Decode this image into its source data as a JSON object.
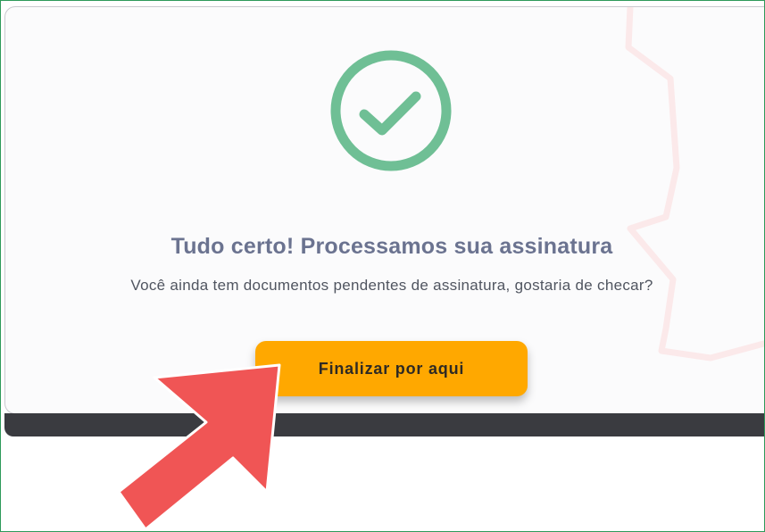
{
  "confirmation": {
    "title": "Tudo certo! Processamos sua assinatura",
    "message": "Você ainda tem documentos pendentes de assinatura, gostaria de checar?",
    "button_label": "Finalizar por aqui",
    "icon": "check-circle-icon"
  },
  "overlay": {
    "icon": "pointer-arrow-icon"
  },
  "colors": {
    "success_green": "#6fbf95",
    "button_orange": "#ffa800",
    "title_text": "#6b7390",
    "arrow_red": "#f05555",
    "frame_border": "#2e9a5a"
  }
}
